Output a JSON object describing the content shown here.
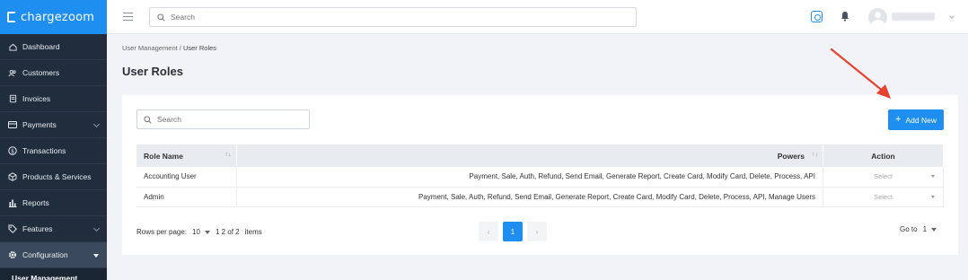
{
  "brand": {
    "name": "chargezoom",
    "color": "#1f8ef1"
  },
  "sidebar": {
    "items": [
      {
        "label": "Dashboard",
        "icon": "home-icon",
        "has_chevron": false
      },
      {
        "label": "Customers",
        "icon": "users-icon",
        "has_chevron": false
      },
      {
        "label": "Invoices",
        "icon": "invoice-icon",
        "has_chevron": false
      },
      {
        "label": "Payments",
        "icon": "card-icon",
        "has_chevron": true
      },
      {
        "label": "Transactions",
        "icon": "dollar-icon",
        "has_chevron": false
      },
      {
        "label": "Products & Services",
        "icon": "box-icon",
        "has_chevron": false
      },
      {
        "label": "Reports",
        "icon": "bar-chart-icon",
        "has_chevron": false
      },
      {
        "label": "Features",
        "icon": "tag-icon",
        "has_chevron": true
      },
      {
        "label": "Configuration",
        "icon": "gear-icon",
        "has_chevron": true,
        "active": true
      }
    ],
    "sub_item": "User Management"
  },
  "topbar": {
    "search_placeholder": "Search"
  },
  "breadcrumb": {
    "parent": "User Management",
    "separator": " / ",
    "current": "User Roles"
  },
  "page_title": "User Roles",
  "card": {
    "search_placeholder": "Search",
    "add_button_label": "Add New",
    "table": {
      "headers": {
        "role": "Role Name",
        "powers": "Powers",
        "action": "Action"
      },
      "rows": [
        {
          "role": "Accounting User",
          "powers": "Payment, Sale, Auth, Refund, Send Email, Generate Report, Create Card, Modify Card, Delete, Process, API",
          "action": "Select"
        },
        {
          "role": "Admin",
          "powers": "Payment, Sale, Auth, Refund, Send Email, Generate Report, Create Card, Modify Card, Delete, Process, API, Manage Users",
          "action": "Select"
        }
      ]
    },
    "footer": {
      "rows_per_page_label": "Rows per page:",
      "rows_per_page": "10",
      "range": "1  2 of 2",
      "items_label": "items",
      "current_page": "1",
      "goto_label": "Go to",
      "goto_value": "1"
    }
  }
}
